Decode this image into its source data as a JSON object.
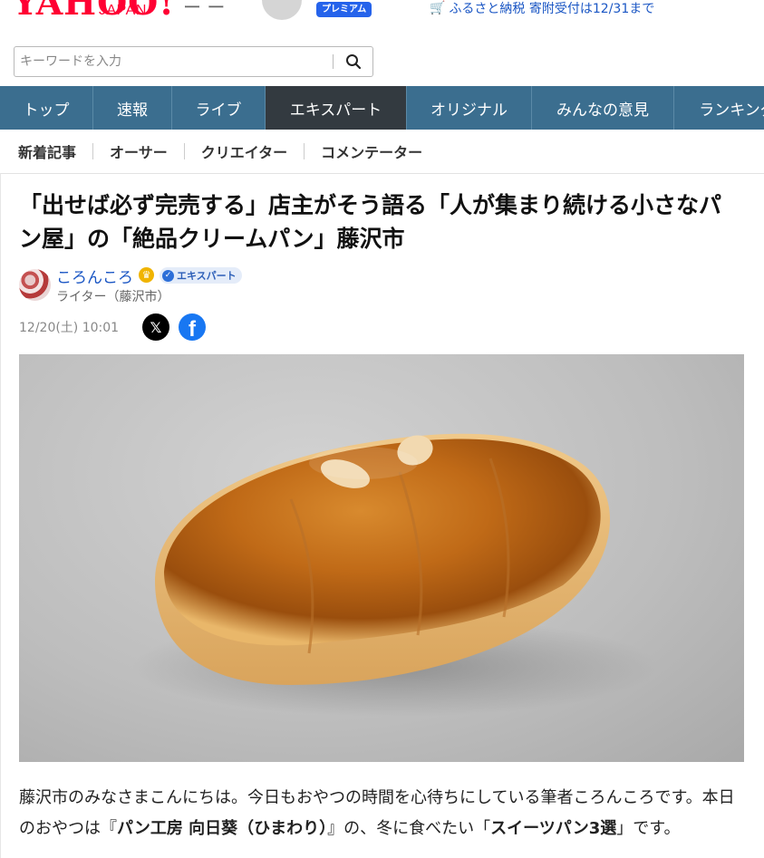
{
  "header": {
    "logo_main": "YAHOO!",
    "logo_sub": "JAPAN",
    "dash": "ー ー",
    "premium": "プレミアム",
    "furusato": "ふるさと納税 寄附受付は12/31まで"
  },
  "search": {
    "placeholder": "キーワードを入力"
  },
  "nav": {
    "items": [
      "トップ",
      "速報",
      "ライブ",
      "エキスパート",
      "オリジナル",
      "みんなの意見",
      "ランキング"
    ],
    "active": "エキスパート"
  },
  "subnav": {
    "items": [
      "新着記事",
      "オーサー",
      "クリエイター",
      "コメンテーター"
    ]
  },
  "article": {
    "title": "「出せば必ず完売する」店主がそう語る「人が集まり続ける小さなパン屋」の「絶品クリームパン」藤沢市",
    "author_name": "ころんころ",
    "expert_badge": "エキスパート",
    "author_role": "ライター（藤沢市）",
    "date": "12/20(土) 10:01",
    "body_1": "藤沢市のみなさまこんにちは。今日もおやつの時間を心待ちにしている筆者ころんころです。本日のおやつは『",
    "body_bold_1": "パン工房 向日葵（ひまわり）",
    "body_2": "』の、冬に食べたい「",
    "body_bold_2": "スイーツパン3選",
    "body_3": "」です。"
  },
  "colors": {
    "nav_bg": "#3b6e8f",
    "nav_active": "#333a40",
    "link": "#1a56c4",
    "brand_red": "#ff0033"
  },
  "icons": {
    "search": "search-icon",
    "cart": "cart-icon",
    "crown": "crown-icon",
    "x": "x-logo-icon",
    "facebook": "facebook-icon"
  }
}
